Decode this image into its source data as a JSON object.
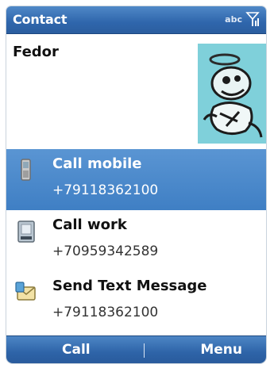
{
  "titlebar": {
    "title": "Contact",
    "input_mode": "abc",
    "icons": [
      "signal-icon"
    ]
  },
  "contact": {
    "name": "Fedor",
    "photo": "contact-photo"
  },
  "actions": [
    {
      "label": "Call mobile",
      "number": "+79118362100",
      "icon": "mobile-phone-icon",
      "selected": true
    },
    {
      "label": "Call work",
      "number": "+70959342589",
      "icon": "office-phone-icon",
      "selected": false
    },
    {
      "label": "Send Text Message",
      "number": "+79118362100",
      "icon": "text-message-icon",
      "selected": false
    }
  ],
  "softkeys": {
    "left": "Call",
    "right": "Menu"
  },
  "colors": {
    "accent": "#2f66ac",
    "selection": "#4a88cc"
  }
}
